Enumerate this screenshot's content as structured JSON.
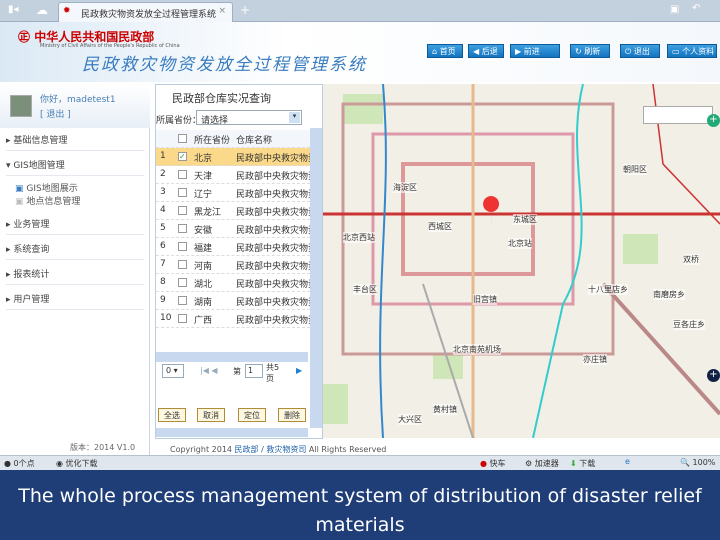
{
  "browser": {
    "tab_title": "民政救灾物资发放全过程管理系统",
    "new_tab": "+",
    "close": "×"
  },
  "header": {
    "logo_cn": "中华人民共和国民政部",
    "logo_en": "Ministry of Civil Affairs of the People's Republic of China",
    "system_title": "民政救灾物资发放全过程管理系统",
    "buttons": [
      {
        "icon": "home-icon",
        "label": "首页"
      },
      {
        "icon": "back-icon",
        "label": "后退"
      },
      {
        "icon": "forward-icon",
        "label": "前进"
      },
      {
        "icon": "refresh-icon",
        "label": "刷新"
      },
      {
        "icon": "power-icon",
        "label": "退出"
      },
      {
        "icon": "user-icon",
        "label": "个人资料"
      }
    ]
  },
  "user": {
    "name": "你好，madetest1",
    "logout": "[ 退出 ]"
  },
  "sidebar": {
    "menu": [
      {
        "label": "基础信息管理",
        "expanded": false
      },
      {
        "label": "GIS地图管理",
        "expanded": true,
        "children": [
          "GIS地图展示",
          "地点信息管理"
        ]
      },
      {
        "label": "业务管理",
        "expanded": false
      },
      {
        "label": "系统查询",
        "expanded": false
      },
      {
        "label": "报表统计",
        "expanded": false
      },
      {
        "label": "用户管理",
        "expanded": false
      }
    ],
    "version": "版本：2014 V1.0"
  },
  "panel": {
    "title": "民政部仓库实况查询",
    "filter_label": "所属省份：",
    "filter_value": "请选择",
    "columns": [
      "所在省份",
      "仓库名称"
    ],
    "rows": [
      {
        "n": "1",
        "province": "北京",
        "name": "民政部中央救灾物资",
        "checked": true
      },
      {
        "n": "2",
        "province": "天津",
        "name": "民政部中央救灾物资",
        "checked": false
      },
      {
        "n": "3",
        "province": "辽宁",
        "name": "民政部中央救灾物资",
        "checked": false
      },
      {
        "n": "4",
        "province": "黑龙江",
        "name": "民政部中央救灾物资",
        "checked": false
      },
      {
        "n": "5",
        "province": "安徽",
        "name": "民政部中央救灾物资",
        "checked": false
      },
      {
        "n": "6",
        "province": "福建",
        "name": "民政部中央救灾物资",
        "checked": false
      },
      {
        "n": "7",
        "province": "河南",
        "name": "民政部中央救灾物资",
        "checked": false
      },
      {
        "n": "8",
        "province": "湖北",
        "name": "民政部中央救灾物资",
        "checked": false
      },
      {
        "n": "9",
        "province": "湖南",
        "name": "民政部中央救灾物资",
        "checked": false
      },
      {
        "n": "10",
        "province": "广西",
        "name": "民政部中央救灾物资",
        "checked": false
      }
    ],
    "pager": {
      "page_size": "0",
      "page_label": "第",
      "page": "1",
      "total": "共5页"
    },
    "actions": [
      "全选",
      "取消",
      "定位",
      "删除"
    ]
  },
  "map": {
    "labels": [
      "海淀区",
      "西城区",
      "东城区",
      "朝阳区",
      "丰台区",
      "北京站",
      "北京西站",
      "北京南苑机场",
      "大兴区",
      "黄村镇",
      "亦庄镇",
      "旧宫镇",
      "十八里店乡",
      "南磨房乡",
      "豆各庄乡",
      "双桥"
    ]
  },
  "footer": {
    "copyright": "Copyright 2014",
    "link": "民政部 / 救灾物资司",
    "rights": "All Rights Reserved"
  },
  "status": {
    "left": [
      "0个点",
      "优化下载"
    ],
    "right": [
      "快车",
      "加速器",
      "下载",
      "100%"
    ]
  },
  "caption": "The whole process management system of distribution of disaster relief materials"
}
